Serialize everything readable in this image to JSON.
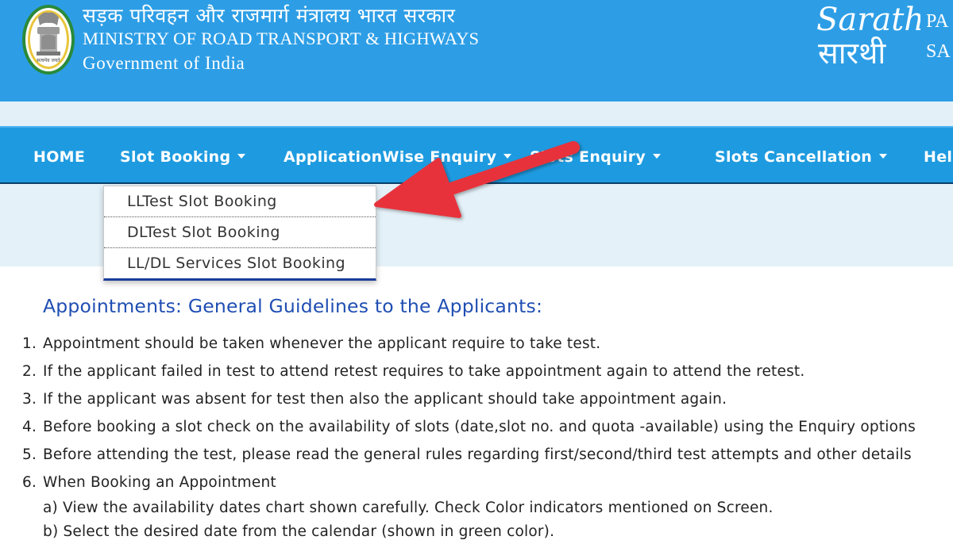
{
  "header": {
    "hindi_title": "सड़क परिवहन और राजमार्ग मंत्रालय भारत सरकार",
    "ministry": "MINISTRY OF ROAD TRANSPORT & HIGHWAYS",
    "government": "Government of India",
    "emblem_motto": "सत्यमेव जयते",
    "sarathi_logo_latin": "Sarathi",
    "sarathi_logo_hindi": "सारथी",
    "side_line1": "PA",
    "side_line2": "SA"
  },
  "nav": {
    "items": [
      {
        "label": "HOME",
        "has_caret": false
      },
      {
        "label": "Slot Booking",
        "has_caret": true
      },
      {
        "label": "ApplicationWise Enquiry",
        "has_caret": true
      },
      {
        "label": "Slots Enquiry",
        "has_caret": true
      },
      {
        "label": "Slots Cancellation",
        "has_caret": true
      },
      {
        "label": "Help",
        "has_caret": false
      }
    ]
  },
  "dropdown": {
    "items": [
      "LLTest Slot Booking",
      "DLTest Slot Booking",
      "LL/DL Services Slot Booking"
    ]
  },
  "content": {
    "title": "Appointments: General Guidelines to the Applicants:",
    "guidelines": [
      "Appointment should be taken whenever the applicant require to take test.",
      "If the applicant failed in test to attend retest requires to take appointment again to attend the retest.",
      "If the applicant was absent for test then also the applicant should take appointment again.",
      "Before booking a slot check on the availability of slots (date,slot no. and quota -available) using the Enquiry options",
      "Before attending the test, please read the general rules regarding first/second/third test attempts and other details",
      "When Booking an Appointment"
    ],
    "numbers": [
      "1.",
      "2.",
      "3.",
      "4.",
      "5.",
      "6."
    ],
    "sub_items": [
      "a) View the availability dates chart shown carefully. Check Color indicators mentioned on Screen.",
      "b) Select the desired date from the calendar (shown in green color)."
    ]
  },
  "colors": {
    "header_bg": "#2d9ee6",
    "nav_bg": "#1e9be0",
    "title_blue": "#1f4eb3",
    "arrow_red": "#e8303a"
  },
  "icons": [
    "national-emblem-icon",
    "sarathi-logo-icon",
    "dropdown-caret-icon",
    "red-pointer-arrow-icon"
  ]
}
